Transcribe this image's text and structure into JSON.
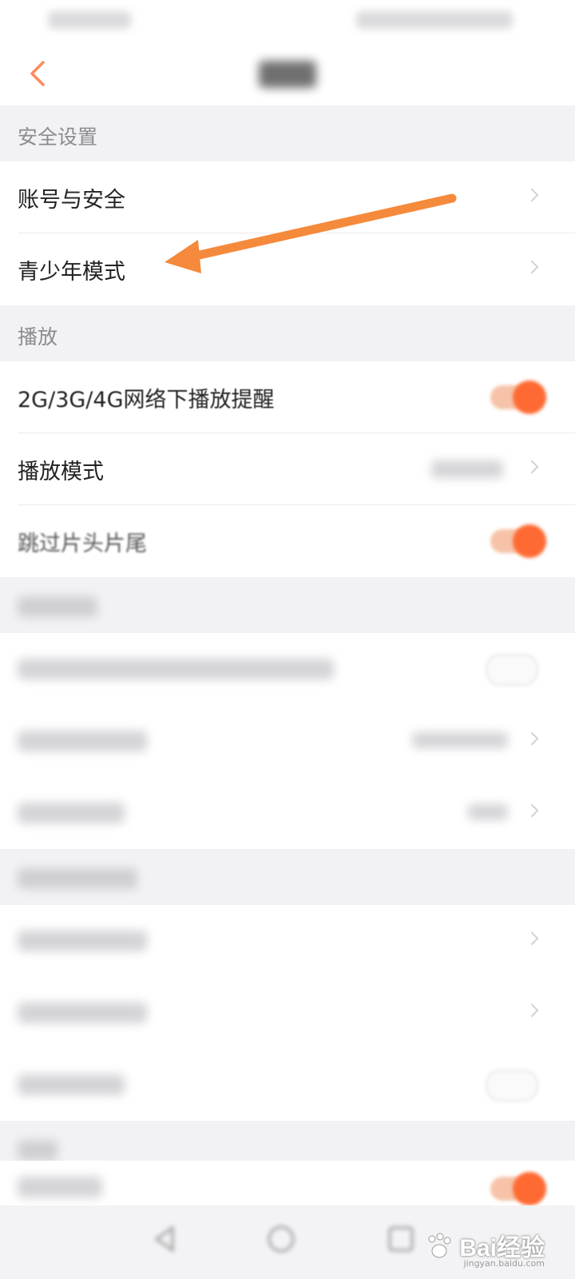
{
  "sections": {
    "security": {
      "title": "安全设置",
      "items": [
        {
          "label": "账号与安全"
        },
        {
          "label": "青少年模式"
        }
      ]
    },
    "playback": {
      "title": "播放",
      "items": [
        {
          "label": "2G/3G/4G网络下播放提醒",
          "toggle": "on"
        },
        {
          "label": "播放模式"
        },
        {
          "label": "跳过片头片尾",
          "toggle": "on"
        }
      ]
    }
  },
  "colors": {
    "accent": "#ff6a33",
    "arrow": "#f58a3c",
    "section_bg": "#f2f2f4"
  },
  "watermark": {
    "text": "Bai经验",
    "url": "jingyan.baidu.com"
  }
}
